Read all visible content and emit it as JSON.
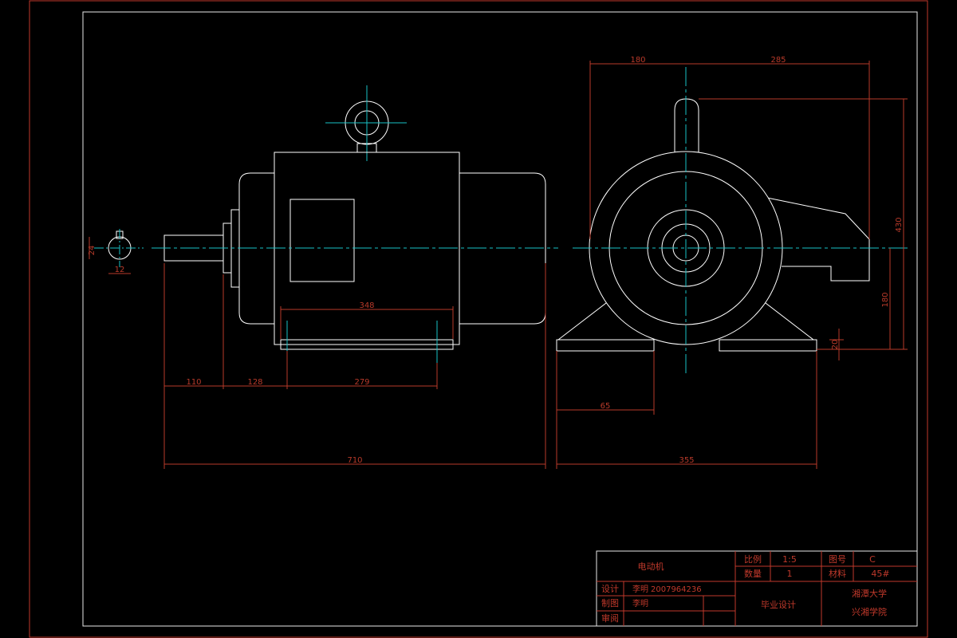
{
  "drawing": {
    "colors": {
      "background": "#000000",
      "frame": "#c0392b",
      "geometry": "#ffffff",
      "centerline": "#19c2c6",
      "dimension": "#b83a2a"
    },
    "dimensions": {
      "front_d348": "348",
      "front_d110": "110",
      "front_d128": "128",
      "front_d279": "279",
      "front_d710": "710",
      "shaft_key_width": "12",
      "shaft_key_depth": "24",
      "side_d180": "180",
      "side_d285": "285",
      "side_d430": "430",
      "side_d180v": "180",
      "side_d20": "20",
      "side_d65": "65",
      "side_d355": "355"
    }
  },
  "title_block": {
    "drawing_name": "电动机",
    "scale_label": "比例",
    "scale_value": "1:5",
    "drawing_no_label": "图号",
    "drawing_no_value": "C",
    "quantity_label": "数量",
    "quantity_value": "1",
    "material_label": "材料",
    "material_value": "45#",
    "design_label": "设计",
    "designer": "李明",
    "student_id": "2007964236",
    "drawing_label": "制图",
    "drawer": "李明",
    "review_label": "审阅",
    "project": "毕业设计",
    "university": "湘潭大学",
    "college": "兴湘学院"
  }
}
